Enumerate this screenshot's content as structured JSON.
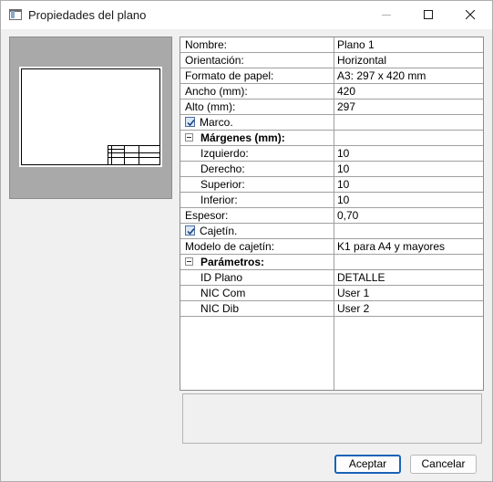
{
  "window": {
    "title": "Propiedades del plano"
  },
  "grid": {
    "rows": [
      {
        "key": "Nombre:",
        "value": "Plano 1"
      },
      {
        "key": "Orientación:",
        "value": "Horizontal"
      },
      {
        "key": "Formato de papel:",
        "value": "A3: 297 x 420 mm"
      },
      {
        "key": "Ancho (mm):",
        "value": "420"
      },
      {
        "key": "Alto (mm):",
        "value": "297"
      },
      {
        "key": "Marco.",
        "value": "",
        "checkbox": true,
        "checked": true
      },
      {
        "key": "Márgenes (mm):",
        "section": true
      },
      {
        "key": "Izquierdo:",
        "value": "10"
      },
      {
        "key": "Derecho:",
        "value": "10"
      },
      {
        "key": "Superior:",
        "value": "10"
      },
      {
        "key": "Inferior:",
        "value": "10"
      },
      {
        "key": "Espesor:",
        "value": "0,70"
      },
      {
        "key": "Cajetín.",
        "value": "",
        "checkbox": true,
        "checked": true
      },
      {
        "key": "Modelo de cajetín:",
        "value": "K1 para A4 y mayores"
      },
      {
        "key": "Parámetros:",
        "section": true
      },
      {
        "key": "ID Plano",
        "value": "DETALLE"
      },
      {
        "key": "NIC Com",
        "value": "User 1"
      },
      {
        "key": "NIC Dib",
        "value": "User 2"
      }
    ]
  },
  "buttons": {
    "ok": "Aceptar",
    "cancel": "Cancelar"
  },
  "colors": {
    "accent": "#1a62b8",
    "preview_bg": "#a9a9a9"
  }
}
